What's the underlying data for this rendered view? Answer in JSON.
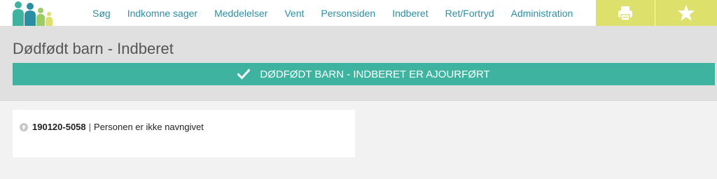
{
  "nav": {
    "items": [
      {
        "label": "Søg"
      },
      {
        "label": "Indkomne sager"
      },
      {
        "label": "Meddelelser"
      },
      {
        "label": "Vent"
      },
      {
        "label": "Personsiden"
      },
      {
        "label": "Indberet"
      },
      {
        "label": "Ret/Fortryd"
      },
      {
        "label": "Administration"
      }
    ],
    "print_icon": "printer-icon",
    "star_icon": "star-icon",
    "logo": "family-logo"
  },
  "page": {
    "title": "Dødfødt barn - Indberet"
  },
  "status": {
    "message": "DØDFØDT BARN - INDBERET ER AJOURFØRT",
    "icon": "checkmark-icon",
    "color": "#3db3a0"
  },
  "person": {
    "cpr": "190120-5058",
    "separator": "|",
    "description": "Personen er ikke navngivet",
    "expand_icon": "plus-circle-icon"
  },
  "colors": {
    "nav_link": "#2b8fa3",
    "toolbar_button": "#dde06b",
    "header_band": "#e0e0e0",
    "page_background": "#f2f2f2"
  }
}
